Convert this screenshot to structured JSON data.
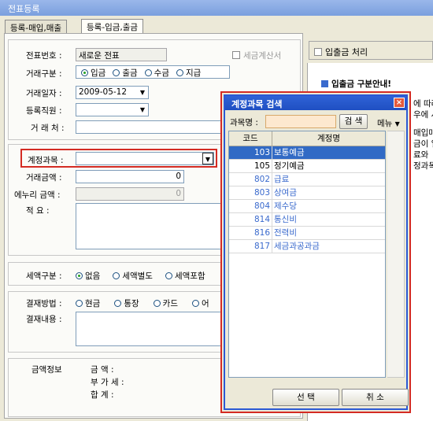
{
  "window": {
    "title": "전표등록"
  },
  "tabs": [
    {
      "label": "등록-매입,매출"
    },
    {
      "label": "등록-입금,출금"
    }
  ],
  "form": {
    "voucher_no_label": "전표번호 :",
    "voucher_no_value": "새로운 전표",
    "tax_invoice_label": "세금계산서",
    "trade_type_label": "거래구분 :",
    "trade_type_options": [
      "입금",
      "출금",
      "수금",
      "지급"
    ],
    "trade_type_selected": "입금",
    "trade_date_label": "거래일자 :",
    "trade_date_value": "2009-05-12",
    "staff_label": "등록직원 :",
    "partner_label": "거 래 처 :",
    "account_label": "계정과목 :",
    "amount_label": "거래금액 :",
    "amount_value": "0",
    "etc_amount_label": "에누리 금액 :",
    "etc_amount_value": "0",
    "memo_label": "적     요 :",
    "tax_type_label": "세액구분 :",
    "tax_type_options": [
      "없음",
      "세액별도",
      "세액포함"
    ],
    "tax_type_selected": "없음",
    "pay_method_label": "결재방법 :",
    "pay_method_options": [
      "현금",
      "통장",
      "카드",
      "어"
    ],
    "pay_content_label": "결재내용 :",
    "amount_info_label": "금액정보",
    "amount_info_lines": [
      "금     액 :",
      "부 가 세 :",
      "합     계 :"
    ]
  },
  "right_panel": {
    "checkbox_label": "입출금 처리",
    "guide_title": "입출금 구분안내!",
    "guide_lines": [
      "에 따라",
      "우에 사",
      "",
      "매입매",
      "금이 일",
      "",
      "료와",
      "정과목"
    ]
  },
  "dialog": {
    "title": "계정과목 검색",
    "search_label": "과목명 :",
    "search_value": "",
    "search_button": "검 색",
    "menu_button": "메뉴",
    "col_code": "코드",
    "col_name": "계정명",
    "rows": [
      {
        "code": "103",
        "name": "보통예금"
      },
      {
        "code": "105",
        "name": "정기예금"
      },
      {
        "code": "802",
        "name": "급료"
      },
      {
        "code": "803",
        "name": "상여금"
      },
      {
        "code": "804",
        "name": "제수당"
      },
      {
        "code": "814",
        "name": "통신비"
      },
      {
        "code": "816",
        "name": "전력비"
      },
      {
        "code": "817",
        "name": "세금과공과금"
      }
    ],
    "select_button": "선 택",
    "cancel_button": "취 소"
  },
  "colors": {
    "accent_blue": "#316ac5",
    "highlight_red": "#d42b23",
    "title_blue": "#2f62d6"
  }
}
